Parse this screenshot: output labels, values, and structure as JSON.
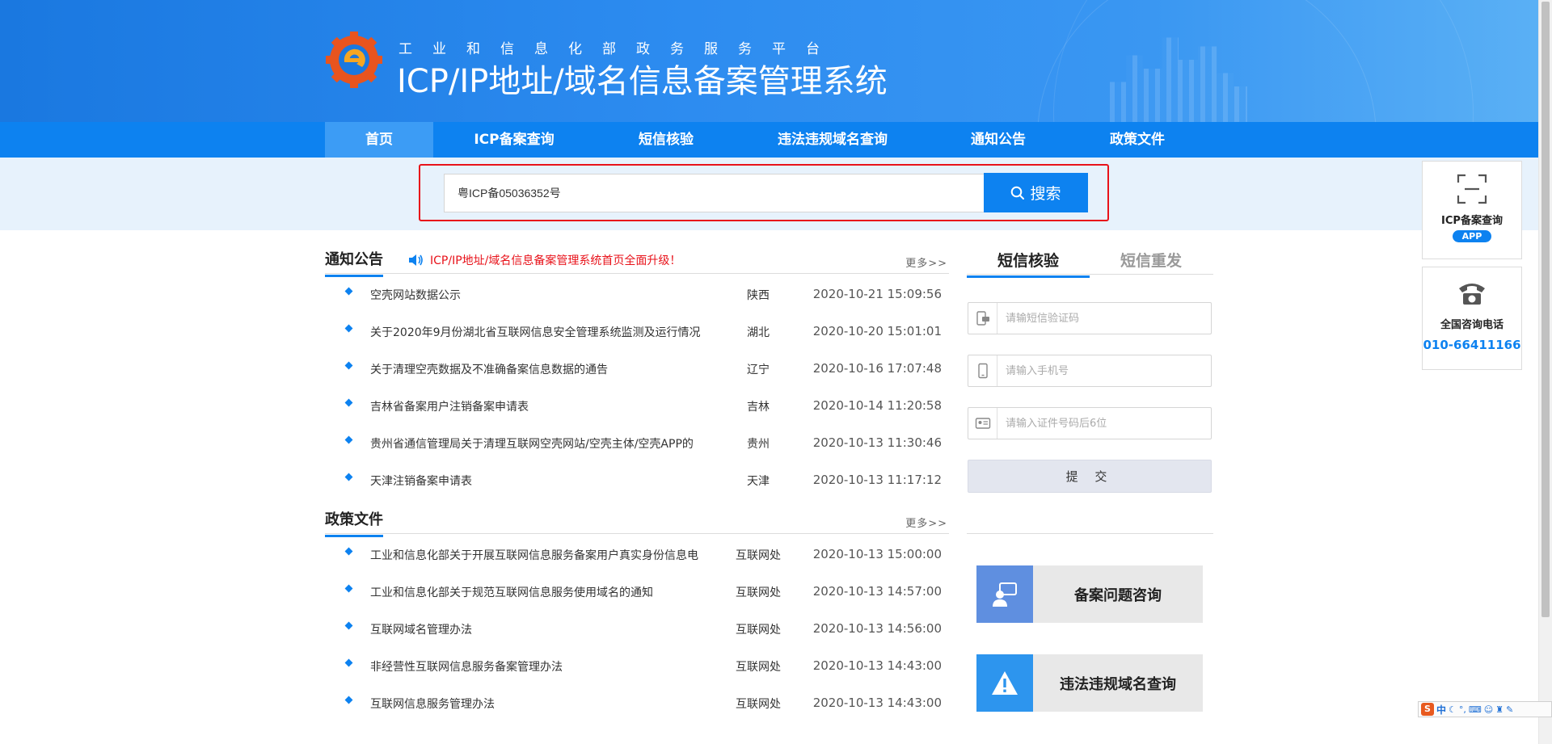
{
  "header": {
    "subtitle": "工业和信息化部政务服务平台",
    "title": "ICP/IP地址/域名信息备案管理系统"
  },
  "nav": {
    "items": [
      {
        "label": "首页",
        "active": true
      },
      {
        "label": "ICP备案查询",
        "active": false
      },
      {
        "label": "短信核验",
        "active": false
      },
      {
        "label": "违法违规域名查询",
        "active": false
      },
      {
        "label": "通知公告",
        "active": false
      },
      {
        "label": "政策文件",
        "active": false
      }
    ]
  },
  "search": {
    "value": "粤ICP备05036352号",
    "button_label": "搜索"
  },
  "notices": {
    "title": "通知公告",
    "marquee": "ICP/IP地址/域名信息备案管理系统首页全面升级！",
    "more": "更多>>",
    "items": [
      {
        "title": "空壳网站数据公示",
        "region": "陕西",
        "time": "2020-10-21 15:09:56"
      },
      {
        "title": "关于2020年9月份湖北省互联网信息安全管理系统监测及运行情况",
        "region": "湖北",
        "time": "2020-10-20 15:01:01"
      },
      {
        "title": "关于清理空壳数据及不准确备案信息数据的通告",
        "region": "辽宁",
        "time": "2020-10-16 17:07:48"
      },
      {
        "title": "吉林省备案用户注销备案申请表",
        "region": "吉林",
        "time": "2020-10-14 11:20:58"
      },
      {
        "title": "贵州省通信管理局关于清理互联网空壳网站/空壳主体/空壳APP的",
        "region": "贵州",
        "time": "2020-10-13 11:30:46"
      },
      {
        "title": "天津注销备案申请表",
        "region": "天津",
        "time": "2020-10-13 11:17:12"
      }
    ]
  },
  "policies": {
    "title": "政策文件",
    "more": "更多>>",
    "items": [
      {
        "title": "工业和信息化部关于开展互联网信息服务备案用户真实身份信息电",
        "region": "互联网处",
        "time": "2020-10-13 15:00:00"
      },
      {
        "title": "工业和信息化部关于规范互联网信息服务使用域名的通知",
        "region": "互联网处",
        "time": "2020-10-13 14:57:00"
      },
      {
        "title": "互联网域名管理办法",
        "region": "互联网处",
        "time": "2020-10-13 14:56:00"
      },
      {
        "title": "非经营性互联网信息服务备案管理办法",
        "region": "互联网处",
        "time": "2020-10-13 14:43:00"
      },
      {
        "title": "互联网信息服务管理办法",
        "region": "互联网处",
        "time": "2020-10-13 14:43:00"
      }
    ]
  },
  "sms": {
    "tab_verify": "短信核验",
    "tab_resend": "短信重发",
    "code_placeholder": "请输短信验证码",
    "phone_placeholder": "请输入手机号",
    "id_placeholder": "请输入证件号码后6位",
    "submit": "提 交"
  },
  "actions": {
    "consult": "备案问题咨询",
    "illegal_query": "违法违规域名查询"
  },
  "float": {
    "app_name": "ICP备案查询",
    "app_badge": "APP",
    "phone_label": "全国咨询电话",
    "phone_number": "010-66411166"
  },
  "ime": {
    "lang": "中"
  },
  "colors": {
    "brand_blue": "#0d82f0",
    "alert_red": "#e8121a"
  }
}
